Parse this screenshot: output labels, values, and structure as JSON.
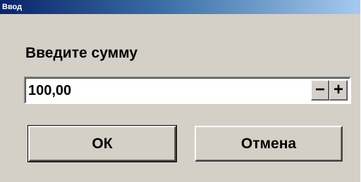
{
  "window": {
    "title": "Ввод"
  },
  "dialog": {
    "prompt": "Введите сумму",
    "amount_value": "100,00",
    "decrement_label": "−",
    "increment_label": "+"
  },
  "buttons": {
    "ok_label": "ОК",
    "cancel_label": "Отмена"
  },
  "colors": {
    "titlebar_start": "#0a246a",
    "titlebar_end": "#a6caf0",
    "dialog_bg": "#d4d0c8"
  }
}
